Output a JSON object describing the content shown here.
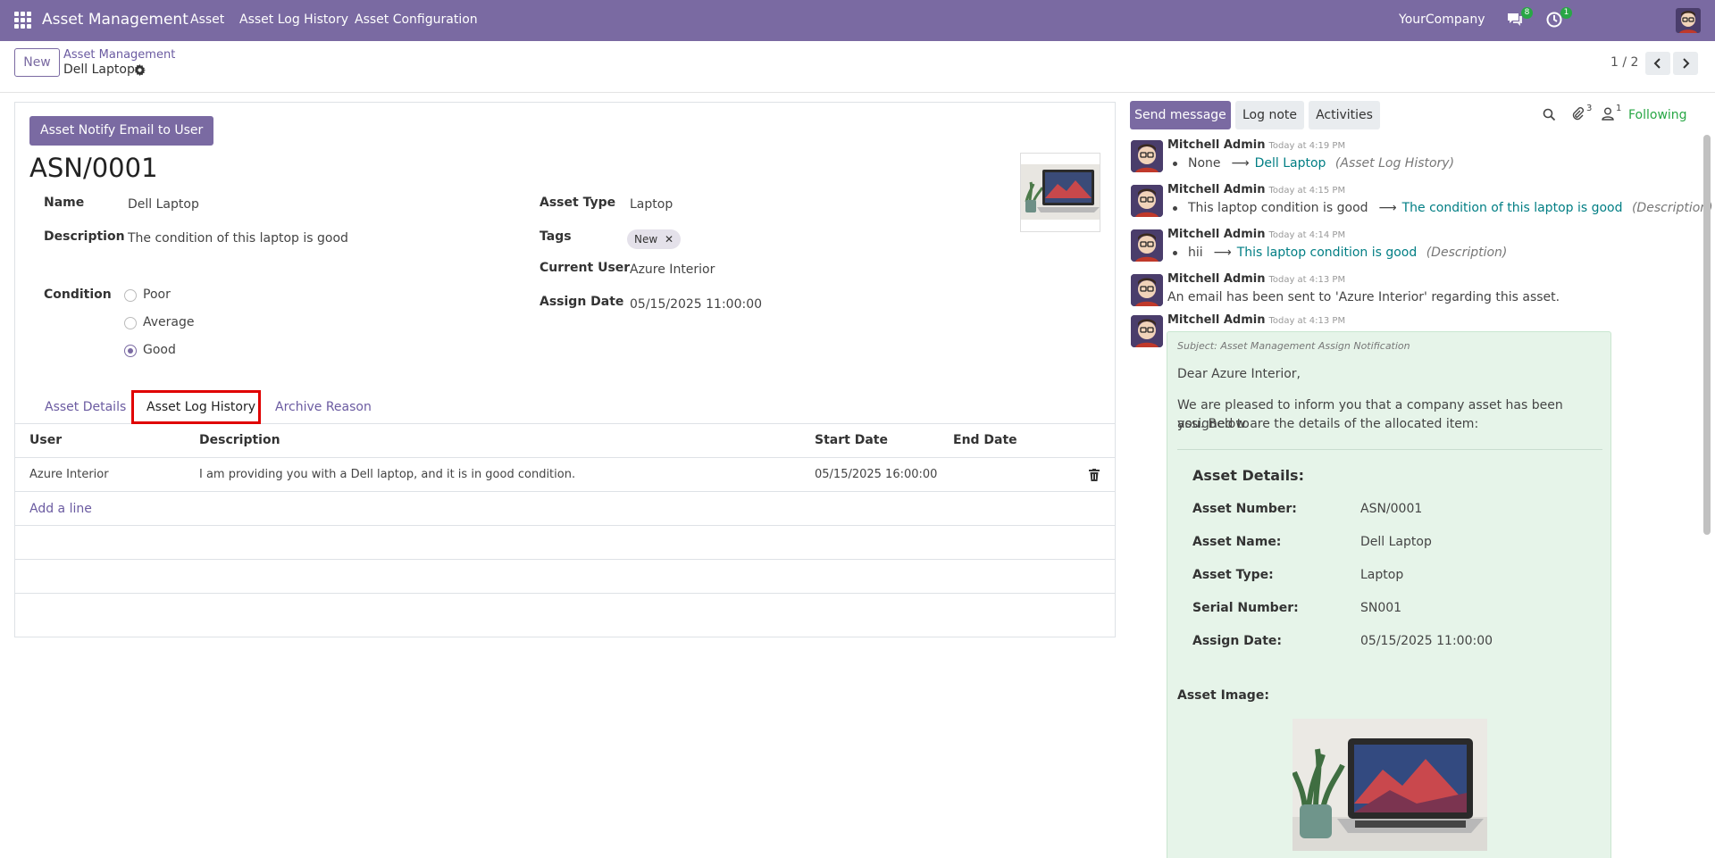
{
  "navbar": {
    "brand": "Asset Management",
    "menu": [
      "Asset",
      "Asset Log History",
      "Asset Configuration"
    ],
    "messages_badge": "8",
    "activities_badge": "1",
    "company": "YourCompany"
  },
  "control_panel": {
    "new_label": "New",
    "breadcrumb_parent": "Asset Management",
    "breadcrumb_current": "Dell Laptop",
    "pager": "1 / 2"
  },
  "form": {
    "notify_button": "Asset Notify Email to User",
    "record_title": "ASN/0001",
    "fields": {
      "name_label": "Name",
      "name_value": "Dell Laptop",
      "description_label": "Description",
      "description_value": "The condition of this laptop is good",
      "condition_label": "Condition",
      "condition_options": [
        "Poor",
        "Average",
        "Good"
      ],
      "condition_selected": "Good",
      "asset_type_label": "Asset Type",
      "asset_type_value": "Laptop",
      "tags_label": "Tags",
      "tag_value": "New",
      "current_user_label": "Current User",
      "current_user_value": "Azure Interior",
      "assign_date_label": "Assign Date",
      "assign_date_value": "05/15/2025 11:00:00"
    },
    "tabs": [
      "Asset Details",
      "Asset Log History",
      "Archive Reason"
    ],
    "active_tab": "Asset Log History",
    "log_table": {
      "columns": [
        "User",
        "Description",
        "Start Date",
        "End Date"
      ],
      "rows": [
        {
          "user": "Azure Interior",
          "description": "I am providing you with a Dell laptop, and it is in good condition.",
          "start": "05/15/2025 16:00:00",
          "end": ""
        }
      ],
      "add_line": "Add a line"
    }
  },
  "chatter": {
    "send_message": "Send message",
    "log_note": "Log note",
    "activities": "Activities",
    "attachments_count": "3",
    "followers_count": "1",
    "following": "Following",
    "messages": [
      {
        "author": "Mitchell Admin",
        "time": "Today at 4:19 PM",
        "old": "None",
        "new": "Dell Laptop",
        "field": "(Asset Log History)"
      },
      {
        "author": "Mitchell Admin",
        "time": "Today at 4:15 PM",
        "old": "This laptop condition is good",
        "new": "The condition of this laptop is good",
        "field": "(Description)"
      },
      {
        "author": "Mitchell Admin",
        "time": "Today at 4:14 PM",
        "old": "hii",
        "new": "This laptop condition is good",
        "field": "(Description)"
      },
      {
        "author": "Mitchell Admin",
        "time": "Today at 4:13 PM",
        "text": "An email has been sent to 'Azure Interior' regarding this asset."
      },
      {
        "author": "Mitchell Admin",
        "time": "Today at 4:13 PM"
      }
    ],
    "email": {
      "subject": "Subject: Asset Management Assign Notification",
      "greeting": "Dear Azure Interior,",
      "intro_line1": "We are pleased to inform you that a company asset has been assigned to",
      "intro_line2": "you. Below are the details of the allocated item:",
      "details_heading": "Asset Details:",
      "details": [
        {
          "key": "Asset Number:",
          "value": "ASN/0001"
        },
        {
          "key": "Asset Name:",
          "value": "Dell Laptop"
        },
        {
          "key": "Asset Type:",
          "value": "Laptop"
        },
        {
          "key": "Serial Number:",
          "value": "SN001"
        },
        {
          "key": "Assign Date:",
          "value": "05/15/2025 11:00:00"
        }
      ],
      "image_label": "Asset Image:"
    }
  }
}
